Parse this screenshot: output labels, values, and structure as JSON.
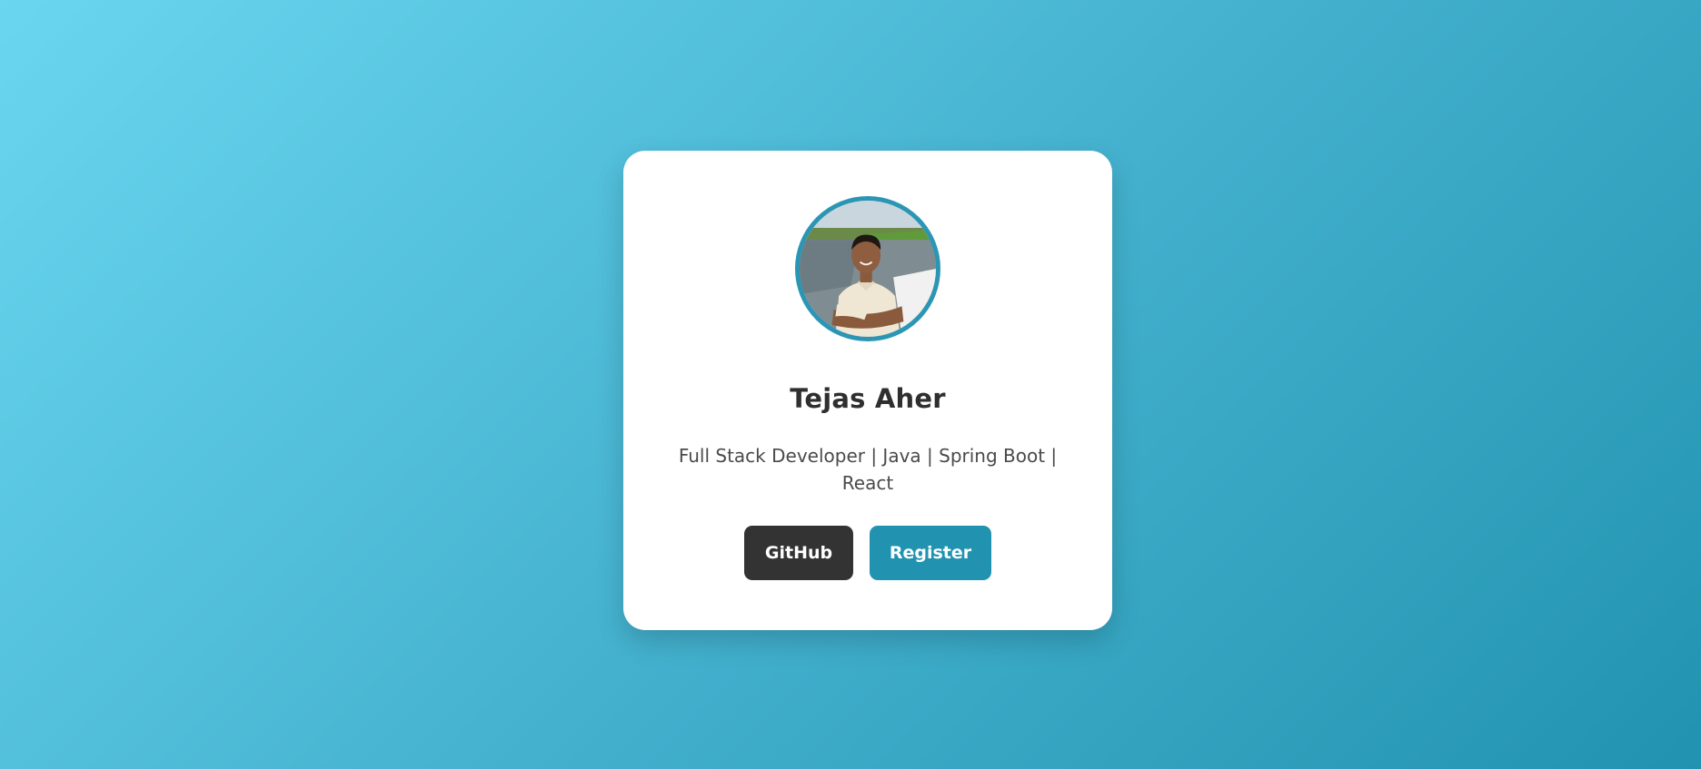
{
  "profile": {
    "name": "Tejas Aher",
    "tagline": "Full Stack Developer | Java | Spring Boot | React",
    "avatar_alt": "profile photo"
  },
  "actions": {
    "github_label": "GitHub",
    "register_label": "Register"
  },
  "colors": {
    "background_start": "#6ad6ef",
    "background_end": "#2193b0",
    "card": "#ffffff",
    "avatar_border": "#2b96b4",
    "github_button": "#333333",
    "register_button": "#2193b0",
    "name_text": "#2f2f2f",
    "tagline_text": "#4a4a4a"
  }
}
